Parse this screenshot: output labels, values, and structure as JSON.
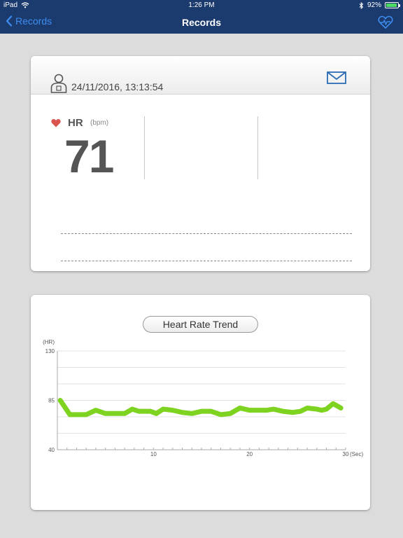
{
  "status_bar": {
    "device": "iPad",
    "time": "1:26 PM",
    "battery": "92%",
    "battery_level": 0.92
  },
  "nav": {
    "back_label": "Records",
    "title": "Records"
  },
  "record": {
    "datetime": "24/11/2016, 13:13:54",
    "hr_label": "HR",
    "hr_unit": "(bpm)",
    "hr_value": "71"
  },
  "trend": {
    "button_label": "Heart Rate Trend"
  },
  "colors": {
    "nav_bg": "#1b3a6e",
    "accent": "#3d8ef0",
    "heart": "#d9534f",
    "line": "#7ed321"
  },
  "chart_data": {
    "type": "line",
    "ylabel": "(HR)",
    "xlabel": "(Sec)",
    "ylim": [
      40,
      130
    ],
    "xlim": [
      0,
      30
    ],
    "yticks": [
      130,
      85,
      40
    ],
    "xticks": [
      10,
      20,
      30
    ],
    "grid": true,
    "series": [
      {
        "x": [
          0.3,
          1.3,
          2.0,
          3.0,
          4.0,
          5.0,
          6.0,
          7.0,
          7.8,
          8.5,
          9.0,
          9.7,
          10.3,
          11.0,
          12.0,
          13.0,
          14.0,
          15.0,
          16.0,
          17.0,
          18.0,
          19.0,
          20.0,
          21.0,
          21.8,
          22.5,
          23.5,
          24.5,
          25.3,
          26.0,
          27.0,
          27.5,
          28.0,
          28.7,
          29.5
        ],
        "values": [
          85,
          72,
          72,
          72,
          76,
          73,
          73,
          73,
          77,
          75,
          75,
          75,
          73,
          77,
          76,
          74,
          73,
          75,
          75,
          72,
          73,
          78,
          76,
          76,
          76,
          77,
          75,
          74,
          75,
          78,
          77,
          76,
          77,
          82,
          78
        ]
      }
    ]
  }
}
